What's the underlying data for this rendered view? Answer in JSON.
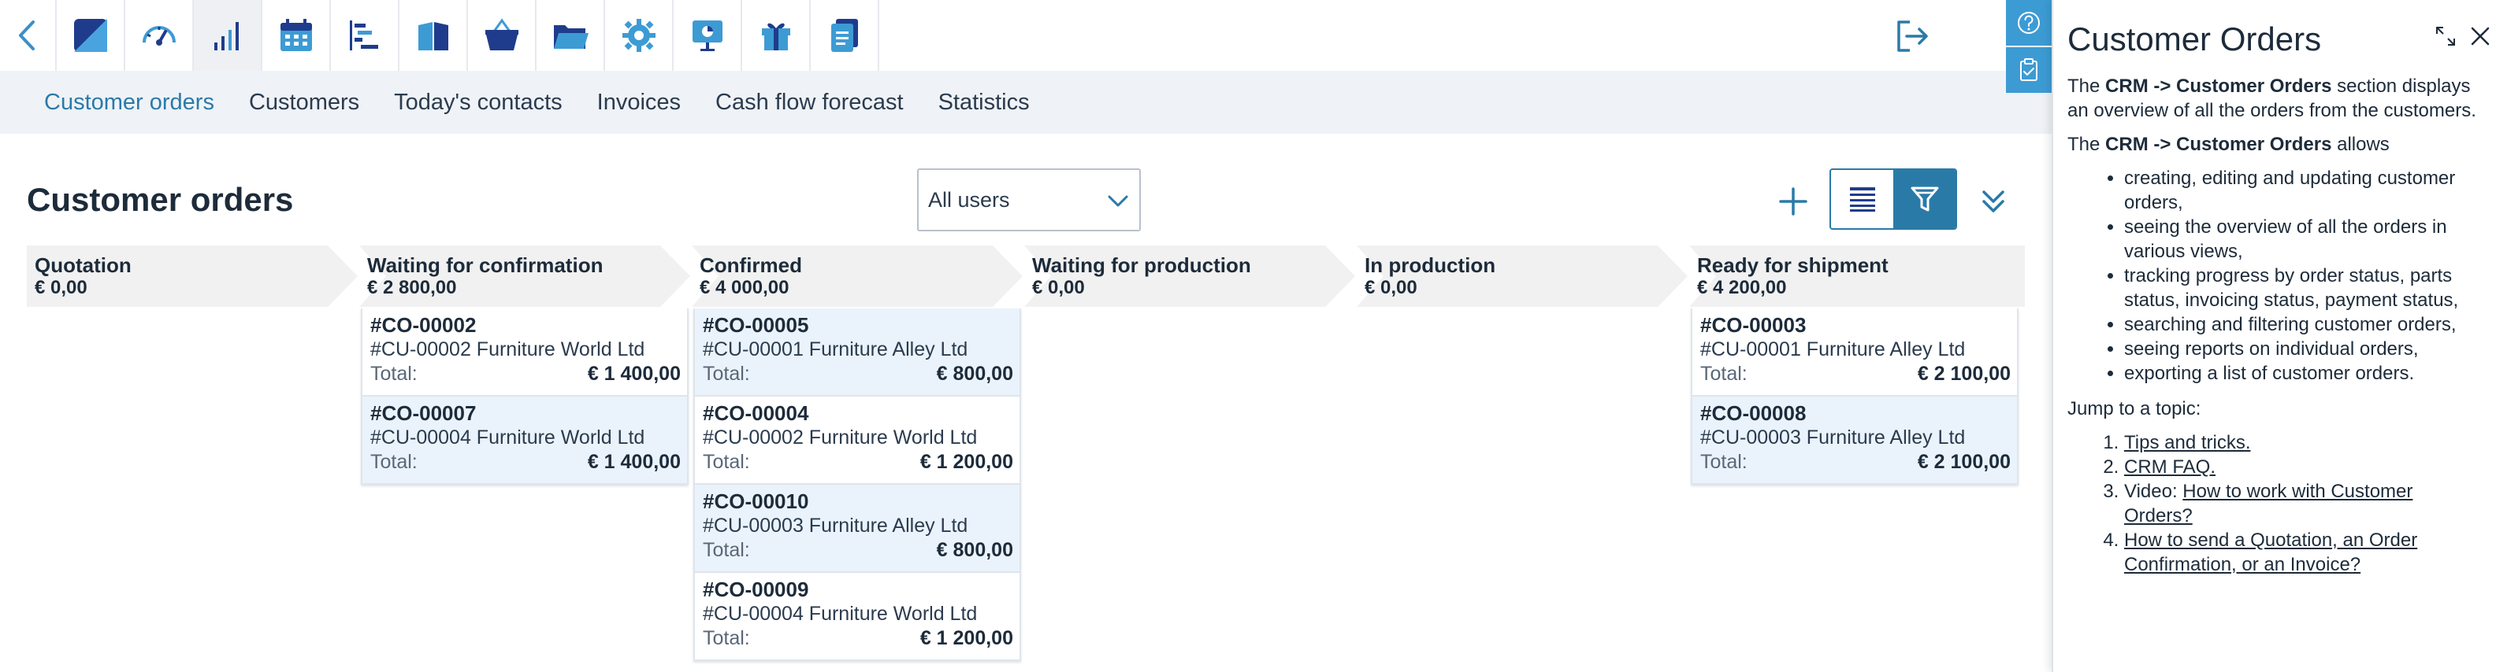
{
  "toolbar": {
    "icons": [
      "back-icon",
      "crm-logo-icon",
      "dashboard-gauge-icon",
      "statistics-bars-icon",
      "calendar-icon",
      "planning-gantt-icon",
      "book-icon",
      "basket-icon",
      "folder-icon",
      "settings-gear-icon",
      "presentation-icon",
      "gift-icon",
      "document-icon",
      "logout-icon"
    ]
  },
  "subnav": {
    "items": [
      "Customer orders",
      "Customers",
      "Today's contacts",
      "Invoices",
      "Cash flow forecast",
      "Statistics"
    ],
    "active": "Customer orders"
  },
  "page": {
    "title": "Customer orders",
    "user_filter": "All users"
  },
  "stages": [
    {
      "name": "Quotation",
      "total": "€ 0,00"
    },
    {
      "name": "Waiting for confirmation",
      "total": "€ 2 800,00"
    },
    {
      "name": "Confirmed",
      "total": "€ 4 000,00"
    },
    {
      "name": "Waiting for production",
      "total": "€ 0,00"
    },
    {
      "name": "In production",
      "total": "€ 0,00"
    },
    {
      "name": "Ready for shipment",
      "total": "€ 4 200,00"
    }
  ],
  "cards": {
    "total_label": "Total:",
    "waiting": [
      {
        "id": "#CO-00002",
        "customer": "#CU-00002 Furniture World Ltd",
        "amount": "€ 1 400,00"
      },
      {
        "id": "#CO-00007",
        "customer": "#CU-00004 Furniture World Ltd",
        "amount": "€ 1 400,00"
      }
    ],
    "confirmed": [
      {
        "id": "#CO-00005",
        "customer": "#CU-00001 Furniture Alley Ltd",
        "amount": "€ 800,00"
      },
      {
        "id": "#CO-00004",
        "customer": "#CU-00002 Furniture World Ltd",
        "amount": "€ 1 200,00"
      },
      {
        "id": "#CO-00010",
        "customer": "#CU-00003 Furniture Alley Ltd",
        "amount": "€ 800,00"
      },
      {
        "id": "#CO-00009",
        "customer": "#CU-00004 Furniture World Ltd",
        "amount": "€ 1 200,00"
      }
    ],
    "ready": [
      {
        "id": "#CO-00003",
        "customer": "#CU-00001 Furniture Alley Ltd",
        "amount": "€ 2 100,00"
      },
      {
        "id": "#CO-00008",
        "customer": "#CU-00003 Furniture Alley Ltd",
        "amount": "€ 2 100,00"
      }
    ]
  },
  "help": {
    "title": "Customer Orders",
    "p1_pre": "The ",
    "p1_bold": "CRM -> Customer Orders",
    "p1_post": " section displays an overview of all the orders from the customers.",
    "p2_pre": "The ",
    "p2_bold": "CRM -> Customer Orders",
    "p2_post": " allows",
    "bullets": [
      "creating, editing and updating customer orders,",
      "seeing the overview of all the orders in various views,",
      "tracking progress by order status, parts status, invoicing status, payment status,",
      "searching and filtering customer orders,",
      "seeing reports on individual orders,",
      "exporting a list of customer orders."
    ],
    "jump_label": "Jump to a topic:",
    "topic1": "Tips and tricks.",
    "topic2": "CRM FAQ.",
    "topic3_pre": "Video: ",
    "topic3_link": "How to work with Customer Orders?",
    "topic4": "How to send a Quotation, an Order Confirmation, or an Invoice?"
  },
  "colors": {
    "accent": "#2a7aa8",
    "side_tab": "#3d9bd4",
    "subnav_bg": "#eff2f6",
    "card_bg": "#eaf3fb",
    "stage_bg": "#f1f1f1"
  }
}
